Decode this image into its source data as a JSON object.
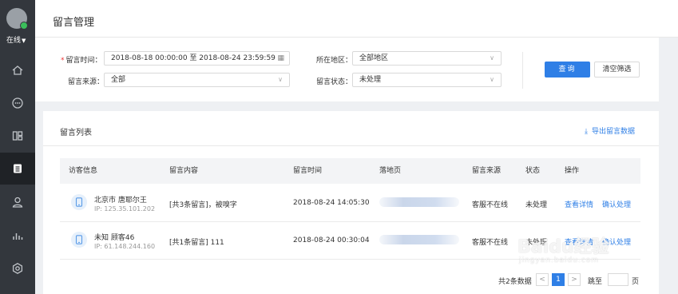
{
  "sidebar": {
    "status": "在线",
    "items": [
      {
        "icon": "home-icon"
      },
      {
        "icon": "chat-icon"
      },
      {
        "icon": "dashboard-icon"
      },
      {
        "icon": "message-icon",
        "active": true
      },
      {
        "icon": "user-icon"
      },
      {
        "icon": "bar-chart-icon"
      },
      {
        "icon": "settings-icon"
      }
    ]
  },
  "header": {
    "title": "留言管理"
  },
  "filters": {
    "time_label": "留言时间：",
    "time_value": "2018-08-18 00:00:00 至 2018-08-24 23:59:59",
    "source_label": "留言来源：",
    "source_value": "全部",
    "region_label": "所在地区：",
    "region_value": "全部地区",
    "status_label": "留言状态：",
    "status_value": "未处理",
    "query_button": "查询",
    "clear_button": "清空筛选"
  },
  "list": {
    "title": "留言列表",
    "export_label": "导出留言数据",
    "columns": [
      "访客信息",
      "留言内容",
      "留言时间",
      "落地页",
      "留言来源",
      "状态",
      "操作"
    ],
    "rows": [
      {
        "visitor": "北京市 唐耶尔王",
        "ip": "IP: 125.35.101.202",
        "content": "[共3条留言]，被嗅字",
        "time": "2018-08-24 14:05:30",
        "source": "客服不在线",
        "status": "未处理",
        "action_view": "查看详情",
        "action_confirm": "确认处理"
      },
      {
        "visitor": "未知 顾客46",
        "ip": "IP: 61.148.244.160",
        "content": "[共1条留言] 111",
        "time": "2018-08-24 00:30:04",
        "source": "客服不在线",
        "status": "未处理",
        "action_view": "查看详情",
        "action_confirm": "确认处理"
      }
    ]
  },
  "pagination": {
    "total": "共2条数据",
    "prev": "<",
    "current": "1",
    "next": ">",
    "jump_label": "跳至",
    "page_unit": "页"
  },
  "watermark": {
    "main": "Baidu经验",
    "sub": "jingyan.baidu.com"
  },
  "colors": {
    "sidebar": "#33373d",
    "primary": "#2f7fe6",
    "online": "#3bbf5b"
  }
}
